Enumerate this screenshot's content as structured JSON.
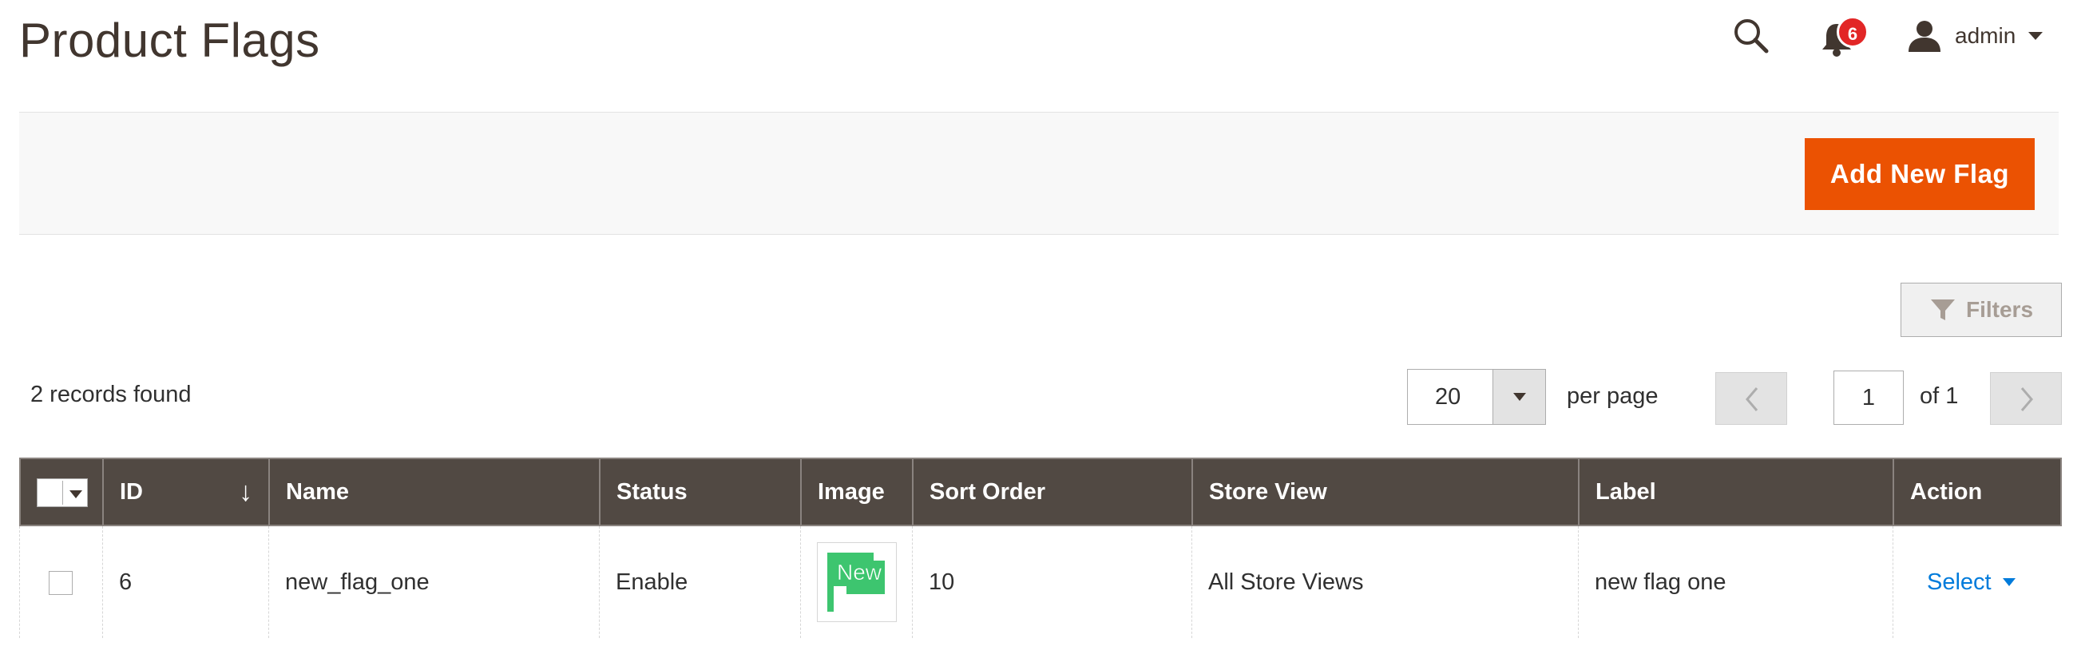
{
  "header": {
    "title": "Product Flags",
    "notifications_count": "6",
    "user_name": "admin",
    "icons": [
      "search-icon",
      "bell-icon",
      "user-icon",
      "chevron-down-icon"
    ]
  },
  "actions": {
    "add_label": "Add New Flag"
  },
  "toolbar": {
    "filters_label": "Filters",
    "records_found": "2 records found",
    "per_page_value": "20",
    "per_page_label": "per page",
    "current_page": "1",
    "page_of": "of 1"
  },
  "grid": {
    "columns": [
      "ID",
      "Name",
      "Status",
      "Image",
      "Sort Order",
      "Store View",
      "Label",
      "Action"
    ],
    "sort_indicator": "↓",
    "rows": [
      {
        "id": "6",
        "name": "new_flag_one",
        "status": "Enable",
        "image_text": "New",
        "sort_order": "10",
        "store_view": "All Store Views",
        "label": "new flag one",
        "action": "Select"
      }
    ]
  },
  "colors": {
    "accent": "#eb5202",
    "grid_header": "#514943",
    "link": "#007bdb",
    "badge": "#e22626",
    "flag_green": "#3dc56f"
  }
}
